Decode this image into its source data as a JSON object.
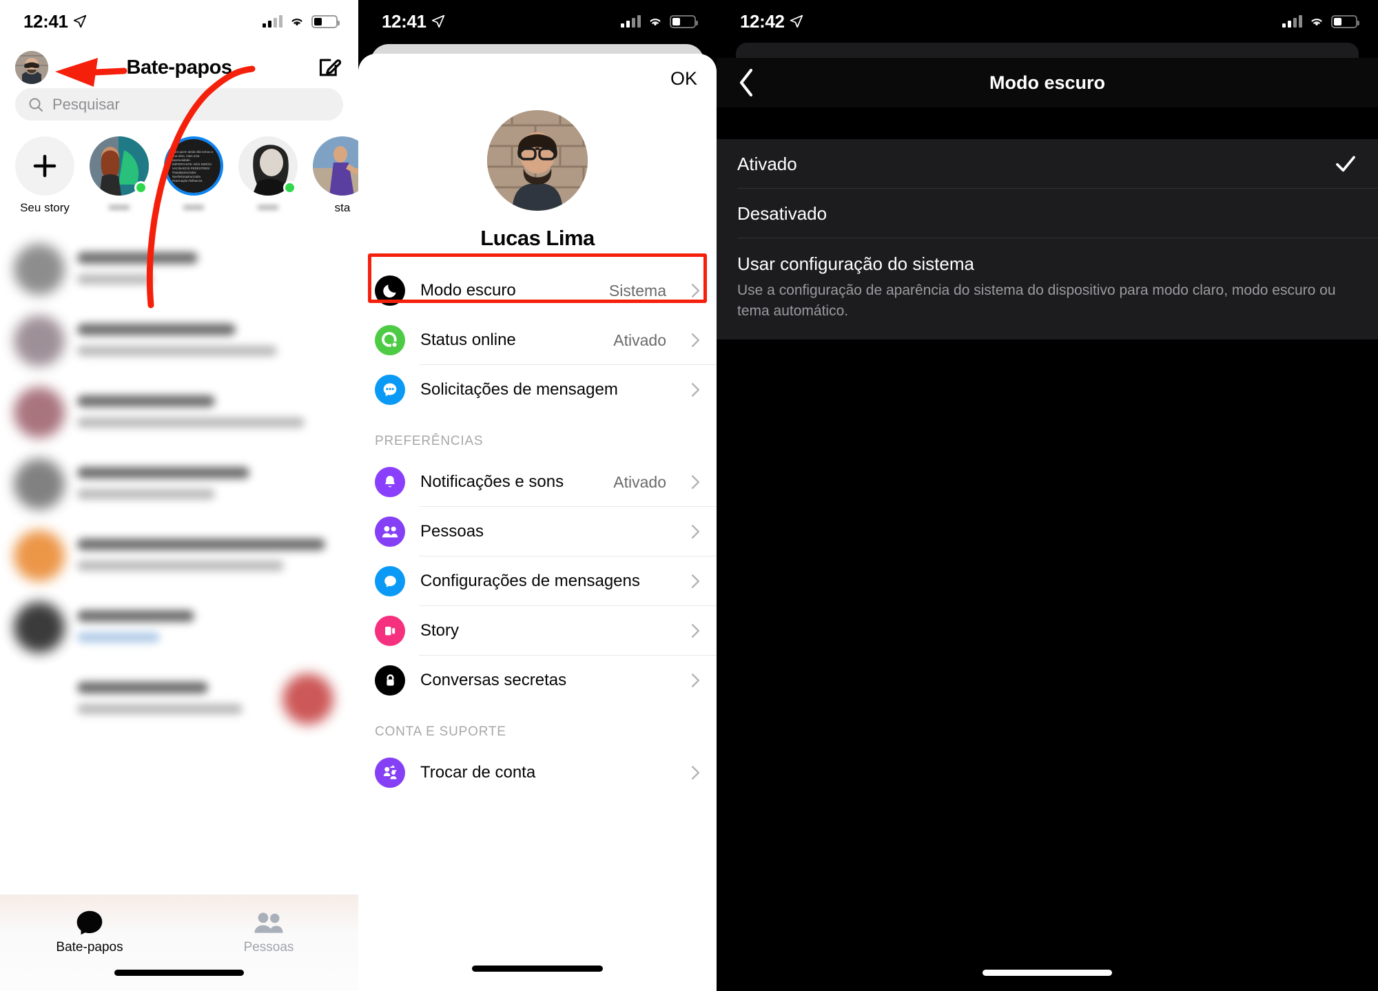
{
  "screen1": {
    "status": {
      "time": "12:41",
      "location_icon": "location-arrow-icon",
      "signal_icon": "cellular-signal-icon",
      "wifi_icon": "wifi-icon",
      "battery_icon": "battery-icon"
    },
    "header": {
      "title": "Bate-papos",
      "avatar": "profile-avatar",
      "compose_icon": "compose-new-message-icon"
    },
    "search": {
      "placeholder": "Pesquisar",
      "icon": "search-icon"
    },
    "stories": [
      {
        "label": "Seu story",
        "type": "add",
        "icon": "plus-icon",
        "online": false
      },
      {
        "label": "",
        "type": "photo",
        "online": true
      },
      {
        "label": "",
        "type": "photo",
        "online": false,
        "unseen": true
      },
      {
        "label": "",
        "type": "photo",
        "online": true
      },
      {
        "label": "sta",
        "type": "photo",
        "online": false
      }
    ],
    "tabs": [
      {
        "label": "Bate-papos",
        "icon": "chat-bubble-icon",
        "active": true
      },
      {
        "label": "Pessoas",
        "icon": "people-icon",
        "active": false
      }
    ],
    "annotation": {
      "arrow_color": "#f5200c",
      "points_to": "profile-avatar"
    }
  },
  "screen2": {
    "status": {
      "time": "12:41"
    },
    "ok_label": "OK",
    "profile": {
      "name": "Lucas Lima",
      "avatar": "profile-photo"
    },
    "items_top": [
      {
        "label": "Modo escuro",
        "value": "Sistema",
        "icon": "moon-icon",
        "icon_color": "#000000",
        "highlighted": true
      },
      {
        "label": "Status online",
        "value": "Ativado",
        "icon": "online-status-icon",
        "icon_color": "#4ecb45",
        "highlighted": false
      },
      {
        "label": "Solicitações de mensagem",
        "value": "",
        "icon": "message-request-icon",
        "icon_color": "#0a9af5",
        "highlighted": false
      }
    ],
    "section_preferences": "PREFERÊNCIAS",
    "items_prefs": [
      {
        "label": "Notificações e sons",
        "value": "Ativado",
        "icon": "bell-icon",
        "icon_color": "#8a3ffc"
      },
      {
        "label": "Pessoas",
        "value": "",
        "icon": "people-icon",
        "icon_color": "#8540f5"
      },
      {
        "label": "Configurações de mensagens",
        "value": "",
        "icon": "chat-bubble-icon",
        "icon_color": "#0a9af5"
      },
      {
        "label": "Story",
        "value": "",
        "icon": "story-cards-icon",
        "icon_color": "#f5317f"
      },
      {
        "label": "Conversas secretas",
        "value": "",
        "icon": "lock-icon",
        "icon_color": "#000000"
      }
    ],
    "section_account": "CONTA E SUPORTE",
    "items_account": [
      {
        "label": "Trocar de conta",
        "value": "",
        "icon": "switch-account-icon",
        "icon_color": "#8540f5"
      }
    ],
    "highlight_color": "#f5200c"
  },
  "screen3": {
    "status": {
      "time": "12:42"
    },
    "nav": {
      "title": "Modo escuro",
      "back_icon": "chevron-left-icon"
    },
    "options": [
      {
        "label": "Ativado",
        "selected": true,
        "desc": ""
      },
      {
        "label": "Desativado",
        "selected": false,
        "desc": ""
      },
      {
        "label": "Usar configuração do sistema",
        "selected": false,
        "desc": "Use a configuração de aparência do sistema do dispositivo para modo claro, modo escuro ou tema automático."
      }
    ],
    "check_icon": "checkmark-icon"
  }
}
